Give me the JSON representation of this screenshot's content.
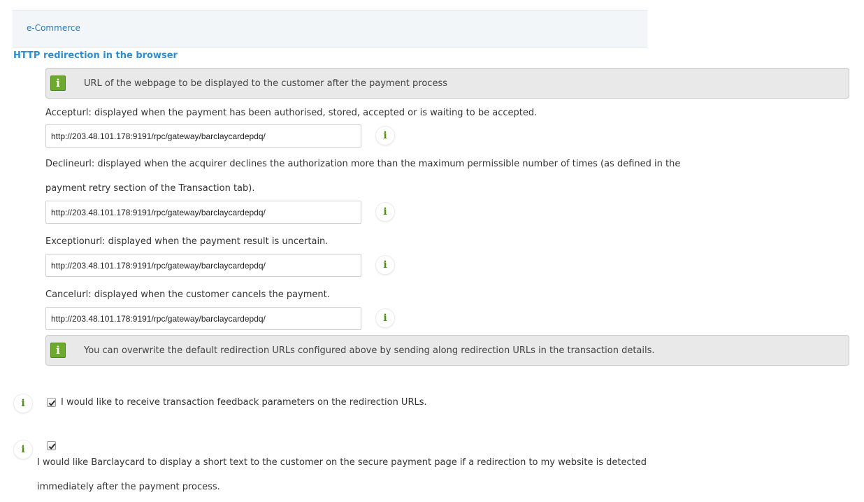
{
  "tab": {
    "label": "e-Commerce"
  },
  "section": {
    "title": "HTTP redirection in the browser"
  },
  "info_top": {
    "text": "URL of the webpage to be displayed to the customer after the payment process"
  },
  "fields": {
    "accept": {
      "label": "Accepturl: displayed when the payment has been authorised, stored, accepted or is waiting to be accepted.",
      "value": "http://203.48.101.178:9191/rpc/gateway/barclaycardepdq/"
    },
    "decline": {
      "label_line1": "Declineurl: displayed when the acquirer declines the authorization more than the maximum permissible number of times (as defined in the",
      "label_line2": "payment retry section of the Transaction tab).",
      "value": "http://203.48.101.178:9191/rpc/gateway/barclaycardepdq/"
    },
    "exception": {
      "label": "Exceptionurl: displayed when the payment result is uncertain.",
      "value": "http://203.48.101.178:9191/rpc/gateway/barclaycardepdq/"
    },
    "cancel": {
      "label": "Cancelurl: displayed when the customer cancels the payment.",
      "value": "http://203.48.101.178:9191/rpc/gateway/barclaycardepdq/"
    }
  },
  "info_bottom": {
    "text": "You can overwrite the default redirection URLs configured above by sending along redirection URLs in the transaction details."
  },
  "options": {
    "feedback": {
      "checked": true,
      "label": "I would like to receive transaction feedback parameters on the redirection URLs."
    },
    "short_text": {
      "checked": true,
      "label_line1": "I would like Barclaycard to display a short text to the customer on the secure payment page if a redirection to my website is detected",
      "label_line2": "immediately after the payment process."
    }
  },
  "icons": {
    "info_glyph": "i",
    "info_icon": "info-icon",
    "check_icon": "checkmark-icon"
  },
  "colors": {
    "accent": "#2a8fd6",
    "info_green": "#6ca92c",
    "info_text_green": "#4e8a14"
  }
}
